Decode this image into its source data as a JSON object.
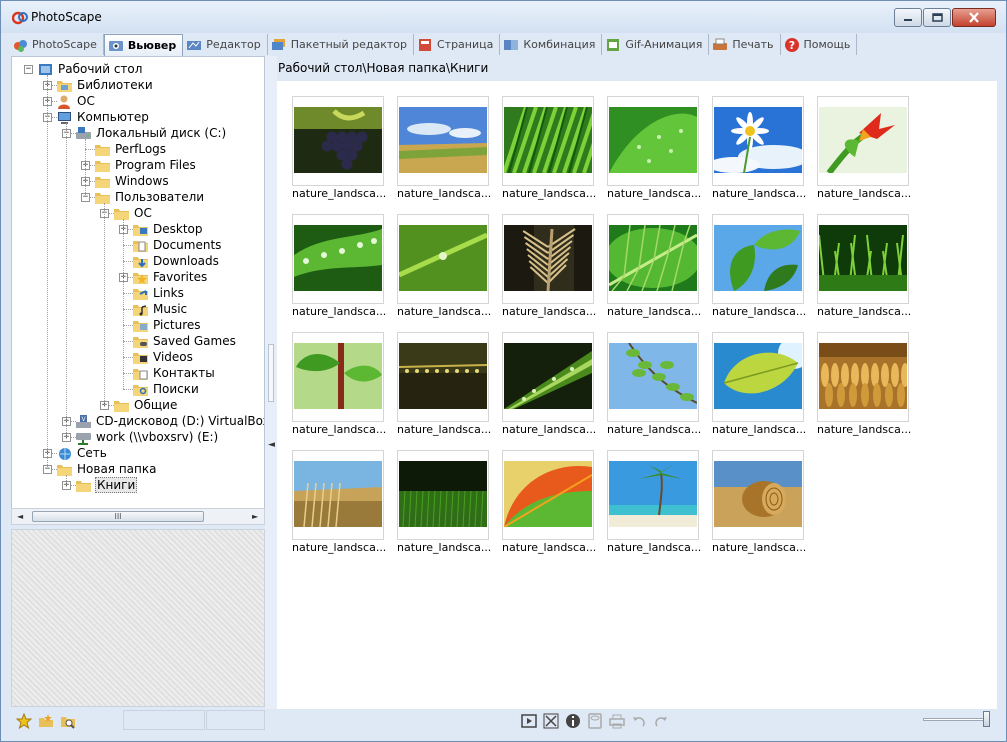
{
  "window": {
    "title": "PhotoScape"
  },
  "tabs": [
    {
      "label": "PhotoScape",
      "icon": "photoscape-icon",
      "active": false
    },
    {
      "label": "Вьювер",
      "icon": "viewer-icon",
      "active": true
    },
    {
      "label": "Редактор",
      "icon": "editor-icon",
      "active": false
    },
    {
      "label": "Пакетный редактор",
      "icon": "batch-editor-icon",
      "active": false
    },
    {
      "label": "Страница",
      "icon": "page-icon",
      "active": false
    },
    {
      "label": "Комбинация",
      "icon": "combine-icon",
      "active": false
    },
    {
      "label": "Gif-Анимация",
      "icon": "gif-animation-icon",
      "active": false
    },
    {
      "label": "Печать",
      "icon": "print-icon",
      "active": false
    },
    {
      "label": "Помощь",
      "icon": "help-icon",
      "active": false
    }
  ],
  "tree": [
    {
      "label": "Рабочий стол",
      "icon": "desktop-icon",
      "level": 0,
      "expander": "minus"
    },
    {
      "label": "Библиотеки",
      "icon": "libraries-icon",
      "level": 1,
      "expander": "plus"
    },
    {
      "label": "ОС",
      "icon": "user-icon",
      "level": 1,
      "expander": "plus"
    },
    {
      "label": "Компьютер",
      "icon": "computer-icon",
      "level": 1,
      "expander": "minus"
    },
    {
      "label": "Локальный диск (C:)",
      "icon": "drive-icon",
      "level": 2,
      "expander": "minus"
    },
    {
      "label": "PerfLogs",
      "icon": "folder-icon",
      "level": 3,
      "expander": ""
    },
    {
      "label": "Program Files",
      "icon": "folder-icon",
      "level": 3,
      "expander": "plus"
    },
    {
      "label": "Windows",
      "icon": "folder-icon",
      "level": 3,
      "expander": "plus"
    },
    {
      "label": "Пользователи",
      "icon": "folder-icon",
      "level": 3,
      "expander": "minus"
    },
    {
      "label": "ОС",
      "icon": "folder-icon",
      "level": 4,
      "expander": "minus"
    },
    {
      "label": "Desktop",
      "icon": "desktop-folder-icon",
      "level": 5,
      "expander": "plus"
    },
    {
      "label": "Documents",
      "icon": "documents-folder-icon",
      "level": 5,
      "expander": ""
    },
    {
      "label": "Downloads",
      "icon": "downloads-folder-icon",
      "level": 5,
      "expander": ""
    },
    {
      "label": "Favorites",
      "icon": "favorites-folder-icon",
      "level": 5,
      "expander": "plus"
    },
    {
      "label": "Links",
      "icon": "links-folder-icon",
      "level": 5,
      "expander": ""
    },
    {
      "label": "Music",
      "icon": "music-folder-icon",
      "level": 5,
      "expander": ""
    },
    {
      "label": "Pictures",
      "icon": "pictures-folder-icon",
      "level": 5,
      "expander": ""
    },
    {
      "label": "Saved Games",
      "icon": "saved-games-folder-icon",
      "level": 5,
      "expander": ""
    },
    {
      "label": "Videos",
      "icon": "videos-folder-icon",
      "level": 5,
      "expander": ""
    },
    {
      "label": "Контакты",
      "icon": "contacts-folder-icon",
      "level": 5,
      "expander": ""
    },
    {
      "label": "Поиски",
      "icon": "searches-folder-icon",
      "level": 5,
      "expander": ""
    },
    {
      "label": "Общие",
      "icon": "folder-icon",
      "level": 4,
      "expander": "plus"
    },
    {
      "label": "CD-дисковод (D:) VirtualBox G",
      "icon": "cd-drive-icon",
      "level": 2,
      "expander": "plus"
    },
    {
      "label": "work (\\\\vboxsrv) (E:)",
      "icon": "network-drive-icon",
      "level": 2,
      "expander": "plus"
    },
    {
      "label": "Сеть",
      "icon": "network-icon",
      "level": 1,
      "expander": "plus"
    },
    {
      "label": "Новая папка",
      "icon": "folder-icon",
      "level": 1,
      "expander": "minus"
    },
    {
      "label": "Книги",
      "icon": "folder-icon",
      "level": 2,
      "expander": "plus",
      "selected": true
    }
  ],
  "scrollbar": {
    "grip": "III"
  },
  "path": "Рабочий стол\\Новая папка\\Книги",
  "thumbnails": [
    {
      "label": "nature_landsca...",
      "subject": "grapes"
    },
    {
      "label": "nature_landsca...",
      "subject": "field-sky"
    },
    {
      "label": "nature_landsca...",
      "subject": "grass-blades"
    },
    {
      "label": "nature_landsca...",
      "subject": "leaf-drops"
    },
    {
      "label": "nature_landsca...",
      "subject": "daisy-sky"
    },
    {
      "label": "nature_landsca...",
      "subject": "red-flower"
    },
    {
      "label": "nature_landsca...",
      "subject": "leaves-drops"
    },
    {
      "label": "nature_landsca...",
      "subject": "grass-drop"
    },
    {
      "label": "nature_landsca...",
      "subject": "wheat-ear"
    },
    {
      "label": "nature_landsca...",
      "subject": "leaf-veins"
    },
    {
      "label": "nature_landsca...",
      "subject": "leaves-blue-sky"
    },
    {
      "label": "nature_landsca...",
      "subject": "grass-sprouts"
    },
    {
      "label": "nature_landsca...",
      "subject": "stem-leaves"
    },
    {
      "label": "nature_landsca...",
      "subject": "dew-string"
    },
    {
      "label": "nature_landsca...",
      "subject": "leaf-macro"
    },
    {
      "label": "nature_landsca...",
      "subject": "branch-sky"
    },
    {
      "label": "nature_landsca...",
      "subject": "leaf-sun"
    },
    {
      "label": "nature_landsca...",
      "subject": "wheat-field"
    },
    {
      "label": "nature_landsca...",
      "subject": "field-dry-grass"
    },
    {
      "label": "nature_landsca...",
      "subject": "green-meadow"
    },
    {
      "label": "nature_landsca...",
      "subject": "autumn-leaf"
    },
    {
      "label": "nature_landsca...",
      "subject": "palm-beach"
    },
    {
      "label": "nature_landsca...",
      "subject": "hay-bale"
    }
  ],
  "statusbar": {
    "left_icons": [
      "star-icon",
      "sparkle-folder-icon",
      "folder-search-icon"
    ],
    "center_icons": [
      "slideshow-icon",
      "fullscreen-icon",
      "info-icon",
      "save-icon",
      "print-icon",
      "rotate-left-icon",
      "rotate-right-icon"
    ]
  },
  "colors": {
    "accent": "#6d8fb5",
    "background": "#dfe9f5"
  }
}
